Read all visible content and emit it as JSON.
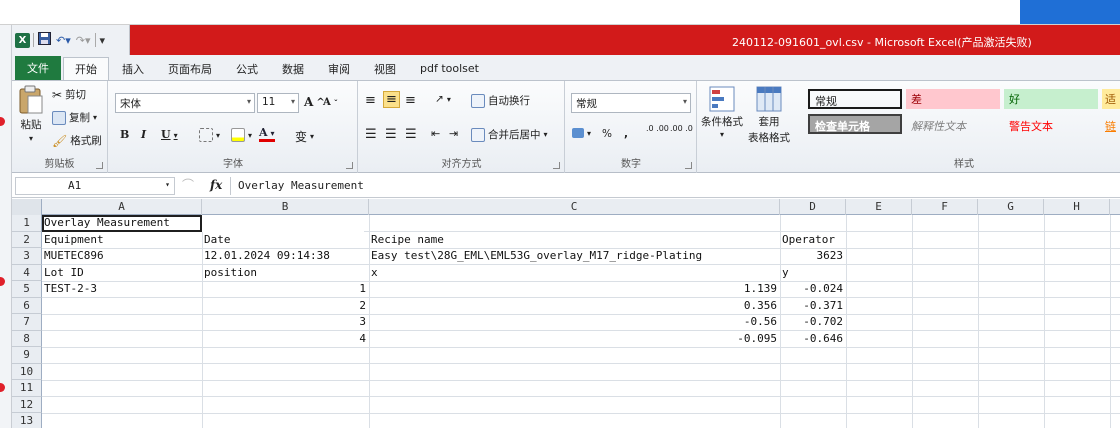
{
  "window": {
    "title": "240112-091601_ovl.csv - Microsoft Excel(产品激活失败)"
  },
  "ribbon": {
    "tabs": [
      "文件",
      "开始",
      "插入",
      "页面布局",
      "公式",
      "数据",
      "审阅",
      "视图",
      "pdf toolset"
    ],
    "clipboard": {
      "label": "剪贴板",
      "paste": "粘贴",
      "cut": "剪切",
      "copy": "复制",
      "format_painter": "格式刷"
    },
    "font": {
      "label": "字体",
      "name": "宋体",
      "size": "11",
      "bold": "B",
      "italic": "I",
      "underline": "U",
      "grow": "A",
      "shrink": "A",
      "wen": "变"
    },
    "alignment": {
      "label": "对齐方式",
      "wrap": "自动换行",
      "merge": "合并后居中"
    },
    "number": {
      "label": "数字",
      "format": "常规",
      "percent": "%",
      "comma": ",",
      "inc_decimal": ".0 .00",
      "dec_decimal": ".00 .0"
    },
    "styles_group": {
      "label": "样式",
      "conditional": "条件格式",
      "table": "套用",
      "table2": "表格格式",
      "cells": [
        {
          "text": "常规",
          "bg": "#ffffff",
          "fg": "#000000"
        },
        {
          "text": "差",
          "bg": "#ffc7ce",
          "fg": "#9c0006"
        },
        {
          "text": "好",
          "bg": "#c6efce",
          "fg": "#006100"
        },
        {
          "text": "适",
          "bg": "#ffeb9c",
          "fg": "#9c5700"
        },
        {
          "text": "检查单元格",
          "bg": "#a5a5a5",
          "fg": "#ffffff"
        },
        {
          "text": "解释性文本",
          "bg": "transparent",
          "fg": "#7f7f7f"
        },
        {
          "text": "警告文本",
          "bg": "transparent",
          "fg": "#ff0000"
        },
        {
          "text": "链",
          "bg": "transparent",
          "fg": "#fa7d00"
        }
      ]
    }
  },
  "formula_bar": {
    "name_box": "A1",
    "fx": "fx",
    "formula": "Overlay Measurement"
  },
  "sheet": {
    "columns": [
      "A",
      "B",
      "C",
      "D",
      "E",
      "F",
      "G",
      "H"
    ],
    "rows": [
      "1",
      "2",
      "3",
      "4",
      "5",
      "6",
      "7",
      "8",
      "9",
      "10",
      "11",
      "12",
      "13"
    ],
    "cells": {
      "r1": {
        "a": "Overlay Measurement"
      },
      "r2": {
        "a": "Equipment",
        "b": "Date",
        "c": "Recipe name",
        "d": "Operator"
      },
      "r3": {
        "a": "MUETEC896",
        "b": "12.01.2024  09:14:38",
        "c": "Easy test\\28G_EML\\EML53G_overlay_M17_ridge-Plating",
        "d": "3623"
      },
      "r4": {
        "a": "Lot ID",
        "b": "position",
        "c": "x",
        "d": "y"
      },
      "r5": {
        "a": "TEST-2-3",
        "b": "1",
        "c": "1.139",
        "d": "-0.024"
      },
      "r6": {
        "b": "2",
        "c": "0.356",
        "d": "-0.371"
      },
      "r7": {
        "b": "3",
        "c": "-0.56",
        "d": "-0.702"
      },
      "r8": {
        "b": "4",
        "c": "-0.095",
        "d": "-0.646"
      }
    }
  }
}
